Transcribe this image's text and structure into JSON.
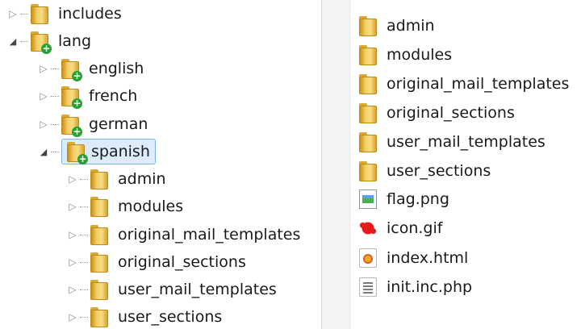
{
  "tree": {
    "items": [
      {
        "label": "includes",
        "expander": "▷",
        "plus": false,
        "selected": false
      },
      {
        "label": "lang",
        "expander": "◢",
        "plus": true,
        "selected": false
      },
      {
        "label": "english",
        "expander": "▷",
        "plus": true,
        "selected": false
      },
      {
        "label": "french",
        "expander": "▷",
        "plus": true,
        "selected": false
      },
      {
        "label": "german",
        "expander": "▷",
        "plus": true,
        "selected": false
      },
      {
        "label": "spanish",
        "expander": "◢",
        "plus": true,
        "selected": true
      },
      {
        "label": "admin",
        "expander": "▷",
        "plus": false,
        "selected": false
      },
      {
        "label": "modules",
        "expander": "▷",
        "plus": false,
        "selected": false
      },
      {
        "label": "original_mail_templates",
        "expander": "▷",
        "plus": false,
        "selected": false
      },
      {
        "label": "original_sections",
        "expander": "▷",
        "plus": false,
        "selected": false
      },
      {
        "label": "user_mail_templates",
        "expander": "▷",
        "plus": false,
        "selected": false
      },
      {
        "label": "user_sections",
        "expander": "▷",
        "plus": false,
        "selected": false
      }
    ]
  },
  "files": {
    "items": [
      {
        "label": "admin",
        "icon": "folder-icon"
      },
      {
        "label": "modules",
        "icon": "folder-icon"
      },
      {
        "label": "original_mail_templates",
        "icon": "folder-icon"
      },
      {
        "label": "original_sections",
        "icon": "folder-icon"
      },
      {
        "label": "user_mail_templates",
        "icon": "folder-icon"
      },
      {
        "label": "user_sections",
        "icon": "folder-icon"
      },
      {
        "label": "flag.png",
        "icon": "png-image-icon"
      },
      {
        "label": "icon.gif",
        "icon": "gif-image-icon"
      },
      {
        "label": "index.html",
        "icon": "html-file-icon"
      },
      {
        "label": "init.inc.php",
        "icon": "php-file-icon"
      }
    ]
  },
  "colors": {
    "selection_bg": "#dcecfc",
    "selection_border": "#7eb4ea",
    "folder": "#f4cf66",
    "plus": "#27a132"
  }
}
